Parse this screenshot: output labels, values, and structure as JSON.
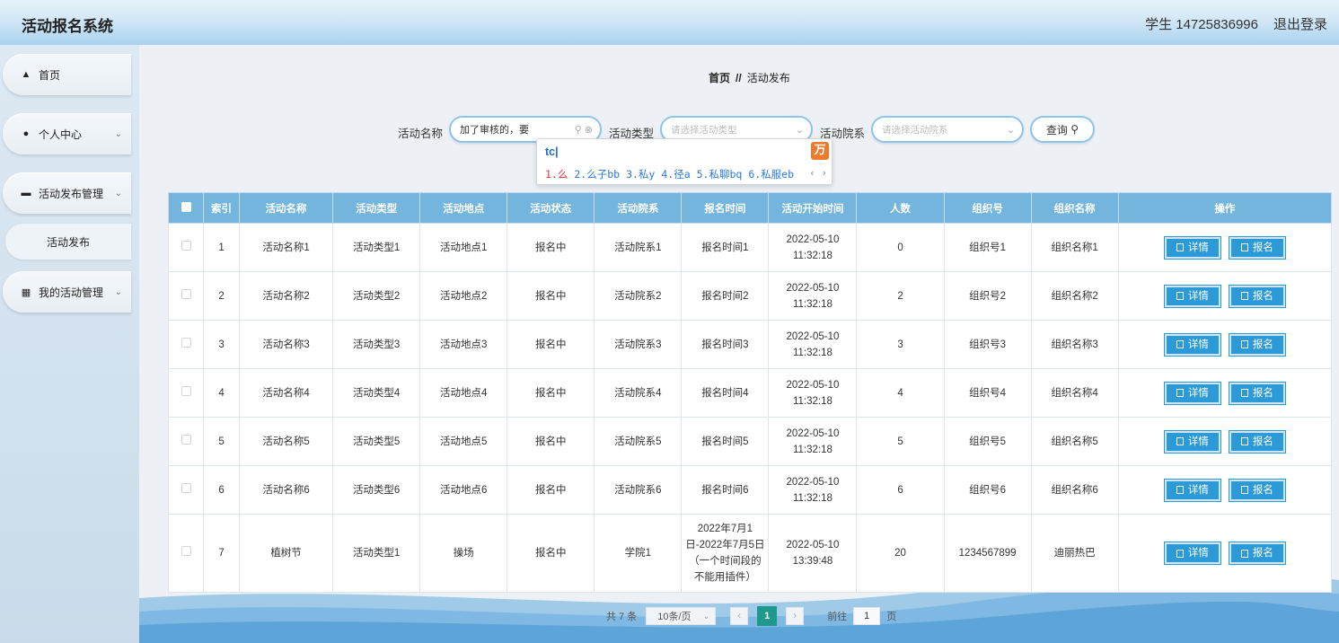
{
  "header": {
    "title": "活动报名系统",
    "user": "学生 14725836996",
    "logout": "退出登录"
  },
  "sidebar": {
    "items": [
      {
        "label": "首页",
        "icon": "home-icon"
      },
      {
        "label": "个人中心",
        "icon": "user-icon"
      },
      {
        "label": "活动发布管理",
        "icon": "briefcase-icon"
      },
      {
        "label": "我的活动管理",
        "icon": "grid-icon"
      }
    ],
    "submenu": "活动发布"
  },
  "breadcrumb": {
    "home": "首页",
    "sep": "//",
    "current": "活动发布"
  },
  "search": {
    "name_label": "活动名称",
    "name_value": "加了审核的，要",
    "type_label": "活动类型",
    "type_placeholder": "请选择活动类型",
    "dept_label": "活动院系",
    "dept_placeholder": "请选择活动院系",
    "query_label": "查询"
  },
  "ime": {
    "composition": "tc",
    "candidates": [
      "1.么",
      "2.么子bb",
      "3.私y",
      "4.径a",
      "5.私聊bq",
      "6.私服eb"
    ]
  },
  "table": {
    "headers": [
      "索引",
      "活动名称",
      "活动类型",
      "活动地点",
      "活动状态",
      "活动院系",
      "报名时间",
      "活动开始时间",
      "人数",
      "组织号",
      "组织名称",
      "操作"
    ],
    "rows": [
      {
        "idx": "1",
        "name": "活动名称1",
        "type": "活动类型1",
        "place": "活动地点1",
        "status": "报名中",
        "dept": "活动院系1",
        "signup": "报名时间1",
        "start": "2022-05-10 11:32:18",
        "count": "0",
        "org_no": "组织号1",
        "org_name": "组织名称1"
      },
      {
        "idx": "2",
        "name": "活动名称2",
        "type": "活动类型2",
        "place": "活动地点2",
        "status": "报名中",
        "dept": "活动院系2",
        "signup": "报名时间2",
        "start": "2022-05-10 11:32:18",
        "count": "2",
        "org_no": "组织号2",
        "org_name": "组织名称2"
      },
      {
        "idx": "3",
        "name": "活动名称3",
        "type": "活动类型3",
        "place": "活动地点3",
        "status": "报名中",
        "dept": "活动院系3",
        "signup": "报名时间3",
        "start": "2022-05-10 11:32:18",
        "count": "3",
        "org_no": "组织号3",
        "org_name": "组织名称3"
      },
      {
        "idx": "4",
        "name": "活动名称4",
        "type": "活动类型4",
        "place": "活动地点4",
        "status": "报名中",
        "dept": "活动院系4",
        "signup": "报名时间4",
        "start": "2022-05-10 11:32:18",
        "count": "4",
        "org_no": "组织号4",
        "org_name": "组织名称4"
      },
      {
        "idx": "5",
        "name": "活动名称5",
        "type": "活动类型5",
        "place": "活动地点5",
        "status": "报名中",
        "dept": "活动院系5",
        "signup": "报名时间5",
        "start": "2022-05-10 11:32:18",
        "count": "5",
        "org_no": "组织号5",
        "org_name": "组织名称5"
      },
      {
        "idx": "6",
        "name": "活动名称6",
        "type": "活动类型6",
        "place": "活动地点6",
        "status": "报名中",
        "dept": "活动院系6",
        "signup": "报名时间6",
        "start": "2022-05-10 11:32:18",
        "count": "6",
        "org_no": "组织号6",
        "org_name": "组织名称6"
      },
      {
        "idx": "7",
        "name": "植树节",
        "type": "活动类型1",
        "place": "操场",
        "status": "报名中",
        "dept": "学院1",
        "signup": "2022年7月1日-2022年7月5日（一个时间段的不能用插件）",
        "start": "2022-05-10 13:39:48",
        "count": "20",
        "org_no": "1234567899",
        "org_name": "迪丽热巴"
      }
    ],
    "detail_btn": "详情",
    "signup_btn": "报名"
  },
  "pager": {
    "total": "共 7 条",
    "size": "10条/页",
    "current": "1",
    "goto_label": "前往",
    "goto_value": "1",
    "page_suffix": "页"
  },
  "colors": {
    "header_th": "#73b5dd",
    "button": "#2c9ad6",
    "page_active": "#1d9a8b",
    "input_border": "#8fc4ea"
  }
}
